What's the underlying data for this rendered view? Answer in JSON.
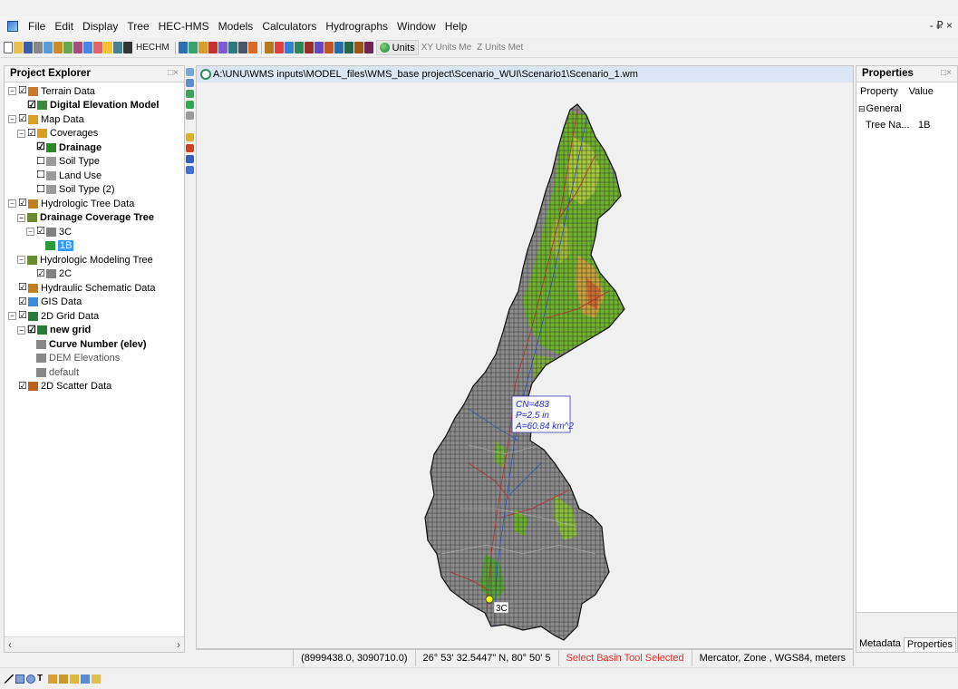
{
  "menubar": {
    "items": [
      "File",
      "Edit",
      "Display",
      "Tree",
      "HEC-HMS",
      "Models",
      "Calculators",
      "Hydrographs",
      "Window",
      "Help"
    ],
    "window_controls": "- ₽ ×"
  },
  "toolbar": {
    "hec_hms_label": "HECHM",
    "units_label": "Units",
    "xy_units_label": "XY Units Me",
    "z_units_label": "Z Units Met"
  },
  "explorer": {
    "title": "Project Explorer",
    "pin": "□×",
    "tree": [
      {
        "label": "Terrain Data",
        "indent": 0,
        "exp": "−",
        "chk": "☑",
        "icon": "terrain-icon",
        "bold": false
      },
      {
        "label": "Digital Elevation Model",
        "indent": 1,
        "exp": "",
        "chk": "☑",
        "icon": "dem-icon",
        "bold": true
      },
      {
        "label": "Map Data",
        "indent": 0,
        "exp": "−",
        "chk": "☑",
        "icon": "map-icon",
        "bold": false
      },
      {
        "label": "Coverages",
        "indent": 1,
        "exp": "−",
        "chk": "☑",
        "icon": "coverage-icon",
        "bold": false
      },
      {
        "label": "Drainage",
        "indent": 2,
        "exp": "",
        "chk": "☑",
        "icon": "drainage-icon",
        "bold": true
      },
      {
        "label": "Soil Type",
        "indent": 2,
        "exp": "",
        "chk": "☐",
        "icon": "soil-icon",
        "bold": false
      },
      {
        "label": "Land Use",
        "indent": 2,
        "exp": "",
        "chk": "☐",
        "icon": "landuse-icon",
        "bold": false
      },
      {
        "label": "Soil Type (2)",
        "indent": 2,
        "exp": "",
        "chk": "☐",
        "icon": "soil-icon",
        "bold": false
      },
      {
        "label": "Hydrologic Tree Data",
        "indent": 0,
        "exp": "−",
        "chk": "☑",
        "icon": "hydro-tree-icon",
        "bold": false
      },
      {
        "label": "Drainage Coverage Tree",
        "indent": 1,
        "exp": "−",
        "chk": "",
        "icon": "tree-icon",
        "bold": true
      },
      {
        "label": "3C",
        "indent": 2,
        "exp": "−",
        "chk": "☑",
        "icon": "outlet-icon",
        "bold": false
      },
      {
        "label": "1B",
        "indent": 3,
        "exp": "",
        "chk": "",
        "icon": "basin-icon",
        "bold": false,
        "selected": true
      },
      {
        "label": "Hydrologic Modeling Tree",
        "indent": 1,
        "exp": "−",
        "chk": "",
        "icon": "tree-icon",
        "bold": false
      },
      {
        "label": "2C",
        "indent": 2,
        "exp": "",
        "chk": "☑",
        "icon": "outlet-icon",
        "bold": false
      },
      {
        "label": "Hydraulic Schematic Data",
        "indent": 0,
        "exp": "",
        "chk": "☑",
        "icon": "hydraulic-icon",
        "bold": false
      },
      {
        "label": "GIS Data",
        "indent": 0,
        "exp": "",
        "chk": "☑",
        "icon": "gis-icon",
        "bold": false
      },
      {
        "label": "2D Grid Data",
        "indent": 0,
        "exp": "−",
        "chk": "☑",
        "icon": "grid-icon",
        "bold": false
      },
      {
        "label": "new grid",
        "indent": 1,
        "exp": "−",
        "chk": "☑",
        "icon": "grid-icon",
        "bold": true
      },
      {
        "label": "Curve Number (elev)",
        "indent": 2,
        "exp": "",
        "chk": "",
        "icon": "dataset-icon",
        "bold": true
      },
      {
        "label": "DEM Elevations",
        "indent": 2,
        "exp": "",
        "chk": "",
        "icon": "dataset-icon",
        "bold": false,
        "faded": true
      },
      {
        "label": "default",
        "indent": 2,
        "exp": "",
        "chk": "",
        "icon": "dataset-icon",
        "bold": false,
        "faded": true
      },
      {
        "label": "2D Scatter Data",
        "indent": 0,
        "exp": "",
        "chk": "☑",
        "icon": "scatter-icon",
        "bold": false
      }
    ],
    "scroll_left": "‹",
    "scroll_right": "›"
  },
  "view": {
    "path": "A:\\UNU\\WMS inputs\\MODEL_files\\WMS_base project\\Scenario_WUI\\Scenario1\\Scenario_1.wm",
    "label_cn": "CN=483",
    "label_p": "P=2.5 in",
    "label_a": "A=60.84 km^2",
    "outlet_label": "3C"
  },
  "statusbar": {
    "coords": "(8999438.0, 3090710.0)",
    "latlon": "26° 53' 32.5447\" N, 80° 50' 5",
    "tool": "Select Basin Tool Selected",
    "projection": "Mercator, Zone , WGS84, meters"
  },
  "properties": {
    "title": "Properties",
    "pin": "□×",
    "col_property": "Property",
    "col_value": "Value",
    "group": "General",
    "rows": [
      {
        "name": "Tree Na...",
        "value": "1B"
      }
    ],
    "tab_metadata": "Metadata",
    "tab_properties": "Properties"
  },
  "colors": {
    "selection": "#3399ff",
    "status_red": "#e0302a",
    "watershed_gray": "#8a8a8a",
    "terrain_green": "#6fb32b"
  }
}
